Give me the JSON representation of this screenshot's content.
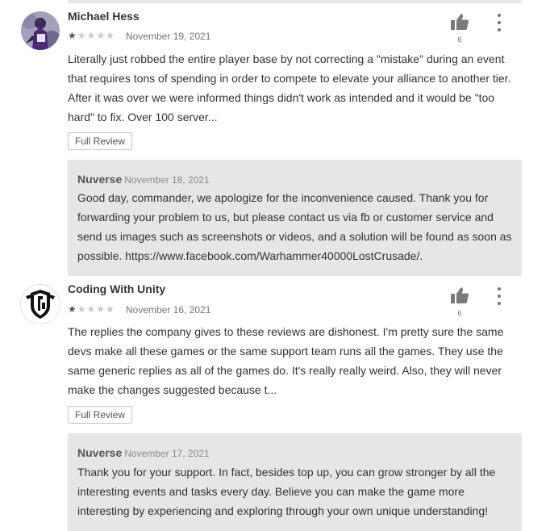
{
  "reviews": [
    {
      "author": "Michael Hess",
      "avatar_icon": "football-player-avatar",
      "rating": 1,
      "rating_max": 5,
      "date": "November 19, 2021",
      "helpful_count": "6",
      "text": "Literally just robbed the entire player base by not correcting a \"mistake\" during an event that requires tons of spending in order to compete to elevate your alliance to another tier. After it was over we were informed things didn't work as intended and it would be \"too hard\" to fix. Over 100 server...",
      "full_review_label": "Full Review",
      "reply": {
        "developer": "Nuverse",
        "date": "November 18, 2021",
        "text": "Good day, commander, we apologize for the inconvenience caused. Thank you for forwarding your problem to us, but please contact us via fb or customer service and send us images such as screenshots or videos, and a solution will be found as soon as possible. https://www.facebook.com/Warhammer40000LostCrusade/."
      }
    },
    {
      "author": "Coding With Unity",
      "avatar_icon": "shield-logo-avatar",
      "rating": 1,
      "rating_max": 5,
      "date": "November 16, 2021",
      "helpful_count": "6",
      "text": "The replies the company gives to these reviews are dishonest. I'm pretty sure the same devs make all these games or the same support team runs all the games. They use the same generic replies as all of the games do. It's really really weird. Also, they will never make the changes suggested because t...",
      "full_review_label": "Full Review",
      "reply": {
        "developer": "Nuverse",
        "date": "November 17, 2021",
        "text": "Thank you for your support. In fact, besides top up, you can grow stronger by all the interesting events and tasks every day. Believe you can make the game more interesting by experiencing and exploring through your own unique understanding!"
      }
    }
  ],
  "icons": {
    "thumb": "thumbs-up-icon",
    "menu": "more-vert-icon"
  },
  "colors": {
    "reply_background": "#e6e6e6",
    "star_filled": "#555555",
    "star_empty": "#c8c8c8"
  }
}
